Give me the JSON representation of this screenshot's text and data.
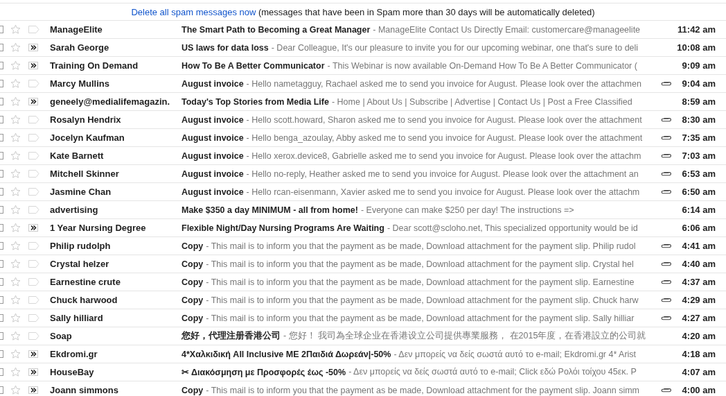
{
  "banner": {
    "link": "Delete all spam messages now",
    "text": " (messages that have been in Spam more than 30 days will be automatically deleted)"
  },
  "messages": [
    {
      "checked": false,
      "starred": false,
      "important": false,
      "sender": "ManageElite",
      "subject": "The Smart Path to Becoming a Great Manager",
      "snippet": "- ManageElite Contact Us Directly Email: customercare@manageelite",
      "attachment": false,
      "time": "11:42 am"
    },
    {
      "checked": false,
      "starred": false,
      "important": true,
      "sender": "Sarah George",
      "subject": "US laws for data loss",
      "snippet": "- Dear Colleague, It's our pleasure to invite you for our upcoming webinar, one that's sure to deli",
      "attachment": false,
      "time": "10:08 am"
    },
    {
      "checked": false,
      "starred": false,
      "important": true,
      "sender": "Training On Demand",
      "subject": "How To Be A Better Communicator",
      "snippet": "- This Webinar is now available On-Demand How To Be A Better Communicator (",
      "attachment": false,
      "time": "9:09 am"
    },
    {
      "checked": false,
      "starred": false,
      "important": false,
      "sender": "Marcy Mullins",
      "subject": "August invoice",
      "snippet": "- Hello nametagguy, Rachael asked me to send you invoice for August. Please look over the attachmen",
      "attachment": true,
      "time": "9:04 am"
    },
    {
      "checked": false,
      "starred": false,
      "important": true,
      "sender": "geneely@medialifemagazin.",
      "subject": "Today's Top Stories from Media Life",
      "snippet": "- Home | About Us | Subscribe | Advertise | Contact Us | Post a Free Classified",
      "attachment": false,
      "time": "8:59 am"
    },
    {
      "checked": false,
      "starred": false,
      "important": false,
      "sender": "Rosalyn Hendrix",
      "subject": "August invoice",
      "snippet": "- Hello scott.howard, Sharon asked me to send you invoice for August. Please look over the attachment",
      "attachment": true,
      "time": "8:30 am"
    },
    {
      "checked": false,
      "starred": false,
      "important": false,
      "sender": "Jocelyn Kaufman",
      "subject": "August invoice",
      "snippet": "- Hello benga_azoulay, Abby asked me to send you invoice for August. Please look over the attachment",
      "attachment": true,
      "time": "7:35 am"
    },
    {
      "checked": false,
      "starred": false,
      "important": false,
      "sender": "Kate Barnett",
      "subject": "August invoice",
      "snippet": "- Hello xerox.device8, Gabrielle asked me to send you invoice for August. Please look over the attachm",
      "attachment": true,
      "time": "7:03 am"
    },
    {
      "checked": false,
      "starred": false,
      "important": false,
      "sender": "Mitchell Skinner",
      "subject": "August invoice",
      "snippet": "- Hello no-reply, Heather asked me to send you invoice for August. Please look over the attachment an",
      "attachment": true,
      "time": "6:53 am"
    },
    {
      "checked": false,
      "starred": false,
      "important": false,
      "sender": "Jasmine Chan",
      "subject": "August invoice",
      "snippet": "- Hello rcan-eisenmann, Xavier asked me to send you invoice for August. Please look over the attachm",
      "attachment": true,
      "time": "6:50 am"
    },
    {
      "checked": false,
      "starred": false,
      "important": false,
      "sender": "advertising",
      "subject": "Make $350 a day MINIMUM - all from home!",
      "snippet": "- Everyone can make $250 per day! The instructions =>",
      "attachment": false,
      "time": "6:14 am"
    },
    {
      "checked": false,
      "starred": false,
      "important": true,
      "sender": "1 Year Nursing Degree",
      "subject": "Flexible Night/Day Nursing Programs Are Waiting",
      "snippet": "- Dear scott@scloho.net, This specialized opportunity would be id",
      "attachment": false,
      "time": "6:06 am"
    },
    {
      "checked": false,
      "starred": false,
      "important": false,
      "sender": "Philip rudolph",
      "subject": "Copy",
      "snippet": "- This mail is to inform you that the payment as be made, Download attachment for the payment slip. Philip rudol",
      "attachment": true,
      "time": "4:41 am"
    },
    {
      "checked": false,
      "starred": false,
      "important": false,
      "sender": "Crystal helzer",
      "subject": "Copy",
      "snippet": "- This mail is to inform you that the payment as be made, Download attachment for the payment slip. Crystal hel",
      "attachment": true,
      "time": "4:40 am"
    },
    {
      "checked": false,
      "starred": false,
      "important": false,
      "sender": "Earnestine crute",
      "subject": "Copy",
      "snippet": "- This mail is to inform you that the payment as be made, Download attachment for the payment slip. Earnestine",
      "attachment": true,
      "time": "4:37 am"
    },
    {
      "checked": false,
      "starred": false,
      "important": false,
      "sender": "Chuck harwood",
      "subject": "Copy",
      "snippet": "- This mail is to inform you that the payment as be made, Download attachment for the payment slip. Chuck harw",
      "attachment": true,
      "time": "4:29 am"
    },
    {
      "checked": false,
      "starred": false,
      "important": false,
      "sender": "Sally hilliard",
      "subject": "Copy",
      "snippet": "- This mail is to inform you that the payment as be made, Download attachment for the payment slip. Sally hilliar",
      "attachment": true,
      "time": "4:27 am"
    },
    {
      "checked": false,
      "starred": false,
      "important": false,
      "sender": "Soap",
      "subject": "您好，代理注册香港公司",
      "snippet": "- 您好！ 我司為全球企业在香港设立公司提供專業服務， 在2015年度，在香港設立的公司就",
      "attachment": false,
      "time": "4:20 am"
    },
    {
      "checked": false,
      "starred": false,
      "important": true,
      "sender": "Ekdromi.gr",
      "subject": "4*Χαλκιδική All Inclusive ΜΕ 2Παιδιά Δωρεάν|-50%",
      "snippet": "- Δεν μπορείς να δείς σωστά αυτό το e-mail; Ekdromi.gr 4* Arist",
      "attachment": false,
      "time": "4:18 am"
    },
    {
      "checked": false,
      "starred": false,
      "important": true,
      "sender": "HouseBay",
      "subject": "✂ Διακόσμηση με Προσφορές έως -50%",
      "snippet": "- Δεν μπορείς να δείς σωστά αυτό το e-mail; Click εδώ Ρολόι τοίχου 45εκ. P",
      "attachment": false,
      "time": "4:07 am"
    },
    {
      "checked": false,
      "starred": false,
      "important": true,
      "sender": "Joann simmons",
      "subject": "Copy",
      "snippet": "- This mail is to inform you that the payment as be made, Download attachment for the payment slip. Joann simm",
      "attachment": true,
      "time": "4:00 am"
    }
  ]
}
